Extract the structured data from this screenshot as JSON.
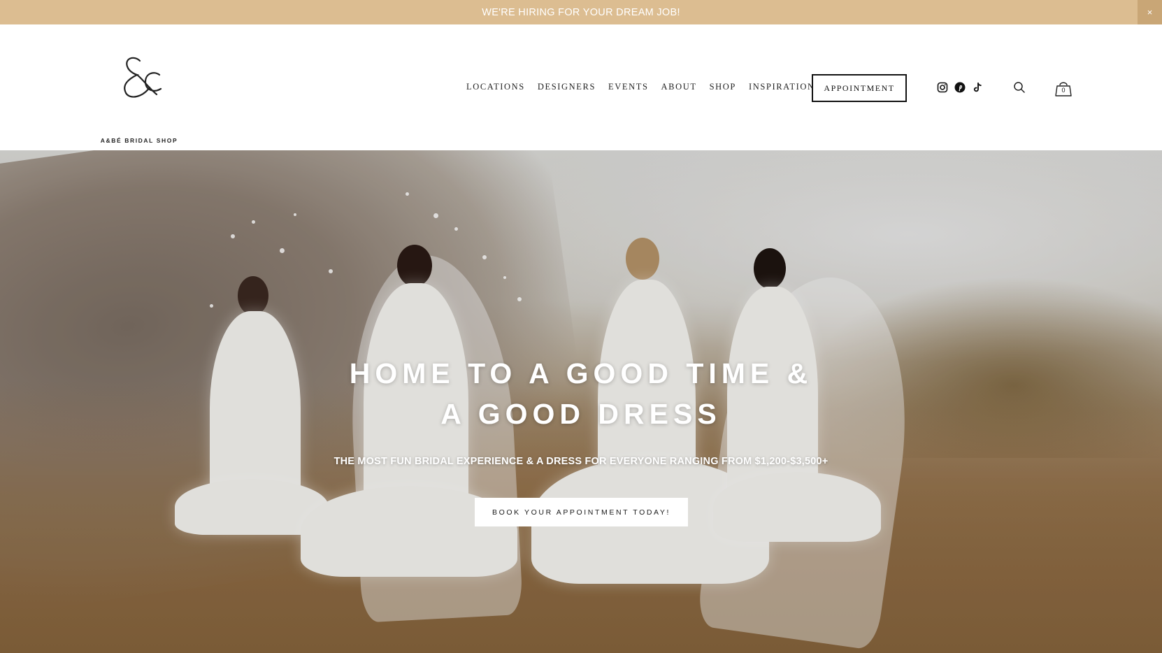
{
  "announcement": {
    "text": "WE'RE HIRING FOR YOUR DREAM JOB!",
    "close_label": "×"
  },
  "brand": {
    "name": "A&BÉ BRIDAL SHOP",
    "logo_icon": "ampersand-monogram"
  },
  "nav": {
    "items": [
      {
        "label": "LOCATIONS"
      },
      {
        "label": "DESIGNERS"
      },
      {
        "label": "EVENTS"
      },
      {
        "label": "ABOUT"
      },
      {
        "label": "SHOP"
      },
      {
        "label": "INSPIRATION"
      }
    ],
    "appointment_label": "APPOINTMENT"
  },
  "social": {
    "icons": [
      "instagram-icon",
      "pinterest-icon",
      "tiktok-icon"
    ]
  },
  "cart": {
    "count": "0"
  },
  "hero": {
    "title_line1": "HOME TO A GOOD TIME &",
    "title_line2": "A GOOD DRESS",
    "subtitle": "THE MOST FUN BRIDAL EXPERIENCE & A DRESS FOR EVERYONE RANGING FROM $1,200-$3,500+",
    "cta_label": "BOOK YOUR APPOINTMENT TODAY!"
  },
  "colors": {
    "announcement_bg": "#dcbd91",
    "text_dark": "#1a1a1a",
    "white": "#ffffff"
  }
}
